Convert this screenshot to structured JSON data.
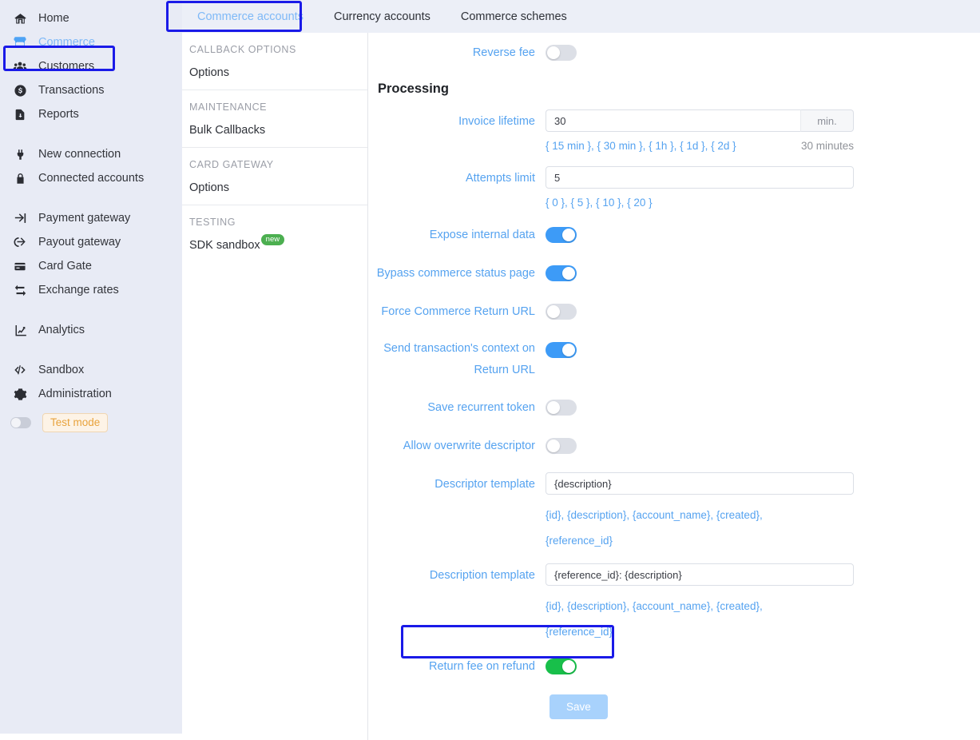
{
  "sidebar": {
    "items": [
      {
        "label": "Home",
        "icon": "home-icon",
        "active": false
      },
      {
        "label": "Commerce",
        "icon": "store-icon",
        "active": true
      },
      {
        "label": "Customers",
        "icon": "users-icon",
        "active": false
      },
      {
        "label": "Transactions",
        "icon": "dollar-circle-icon",
        "active": false
      },
      {
        "label": "Reports",
        "icon": "report-document-icon",
        "active": false
      },
      {
        "label": "New connection",
        "icon": "plug-icon",
        "active": false
      },
      {
        "label": "Connected accounts",
        "icon": "lock-icon",
        "active": false
      },
      {
        "label": "Payment gateway",
        "icon": "sign-in-icon",
        "active": false
      },
      {
        "label": "Payout gateway",
        "icon": "sign-out-icon",
        "active": false
      },
      {
        "label": "Card Gate",
        "icon": "credit-card-icon",
        "active": false
      },
      {
        "label": "Exchange rates",
        "icon": "exchange-icon",
        "active": false
      },
      {
        "label": "Analytics",
        "icon": "chart-line-icon",
        "active": false
      },
      {
        "label": "Sandbox",
        "icon": "code-icon",
        "active": false
      },
      {
        "label": "Administration",
        "icon": "gear-icon",
        "active": false
      }
    ],
    "test_mode_label": "Test mode"
  },
  "tabs": [
    {
      "label": "Commerce accounts",
      "active": true
    },
    {
      "label": "Currency accounts",
      "active": false
    },
    {
      "label": "Commerce schemes",
      "active": false
    }
  ],
  "subnav": [
    {
      "title": "CALLBACK OPTIONS",
      "links": [
        {
          "label": "Options",
          "badge": ""
        }
      ]
    },
    {
      "title": "MAINTENANCE",
      "links": [
        {
          "label": "Bulk Callbacks",
          "badge": ""
        }
      ]
    },
    {
      "title": "CARD GATEWAY",
      "links": [
        {
          "label": "Options",
          "badge": ""
        }
      ]
    },
    {
      "title": "TESTING",
      "links": [
        {
          "label": "SDK sandbox",
          "badge": "new"
        }
      ]
    }
  ],
  "form": {
    "reverse_fee": {
      "label": "Reverse fee",
      "state": "off"
    },
    "section_processing": "Processing",
    "invoice_lifetime": {
      "label": "Invoice lifetime",
      "value": "30",
      "suffix": "min.",
      "hint": "{ 15 min }, { 30 min }, { 1h }, { 1d }, { 2d }",
      "hint_right": "30 minutes"
    },
    "attempts_limit": {
      "label": "Attempts limit",
      "value": "5",
      "hint": "{ 0 }, { 5 }, { 10 }, { 20 }"
    },
    "expose_internal_data": {
      "label": "Expose internal data",
      "state": "on"
    },
    "bypass_commerce_status_page": {
      "label": "Bypass commerce status page",
      "state": "on"
    },
    "force_commerce_return_url": {
      "label": "Force Commerce Return URL",
      "state": "off"
    },
    "send_transaction_context": {
      "label_line1": "Send transaction's context on",
      "label_line2": "Return URL",
      "state": "on"
    },
    "save_recurrent_token": {
      "label": "Save recurrent token",
      "state": "off"
    },
    "allow_overwrite_descriptor": {
      "label": "Allow overwrite descriptor",
      "state": "off"
    },
    "descriptor_template": {
      "label": "Descriptor template",
      "value": "{description}",
      "hint_line1": "{id}, {description}, {account_name}, {created},",
      "hint_line2": "{reference_id}"
    },
    "description_template": {
      "label": "Description template",
      "value": "{reference_id}: {description}",
      "hint_line1": "{id}, {description}, {account_name}, {created},",
      "hint_line2": "{reference_id}"
    },
    "return_fee_on_refund": {
      "label": "Return fee on refund",
      "state": "on-green"
    },
    "save_button": "Save"
  },
  "colors": {
    "highlight_box": "#1a1ae8",
    "accent_blue": "#56a3f0",
    "toggle_on": "#3d9bf7",
    "toggle_on_green": "#18bf4a",
    "sidebar_bg": "#e8ebf5",
    "tabbar_bg": "#eceff7",
    "save_button": "#a8d2fc"
  }
}
